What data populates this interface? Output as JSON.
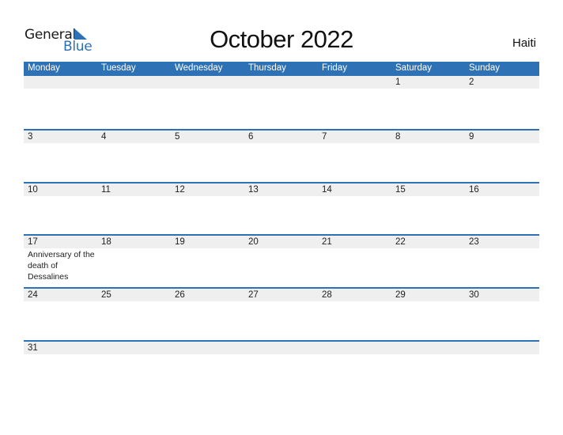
{
  "logo": {
    "text_general": "General",
    "text_blue": "Blue",
    "brand_color": "#2e72b5"
  },
  "title": "October 2022",
  "country": "Haiti",
  "header_color": "#2e72b5",
  "weekdays": [
    "Monday",
    "Tuesday",
    "Wednesday",
    "Thursday",
    "Friday",
    "Saturday",
    "Sunday"
  ],
  "weeks": [
    [
      "",
      "",
      "",
      "",
      "",
      "1",
      "2"
    ],
    [
      "3",
      "4",
      "5",
      "6",
      "7",
      "8",
      "9"
    ],
    [
      "10",
      "11",
      "12",
      "13",
      "14",
      "15",
      "16"
    ],
    [
      "17",
      "18",
      "19",
      "20",
      "21",
      "22",
      "23"
    ],
    [
      "24",
      "25",
      "26",
      "27",
      "28",
      "29",
      "30"
    ],
    [
      "31",
      "",
      "",
      "",
      "",
      "",
      ""
    ]
  ],
  "events": [
    {
      "date": "17",
      "label": "Anniversary of the death of Dessalines"
    }
  ]
}
